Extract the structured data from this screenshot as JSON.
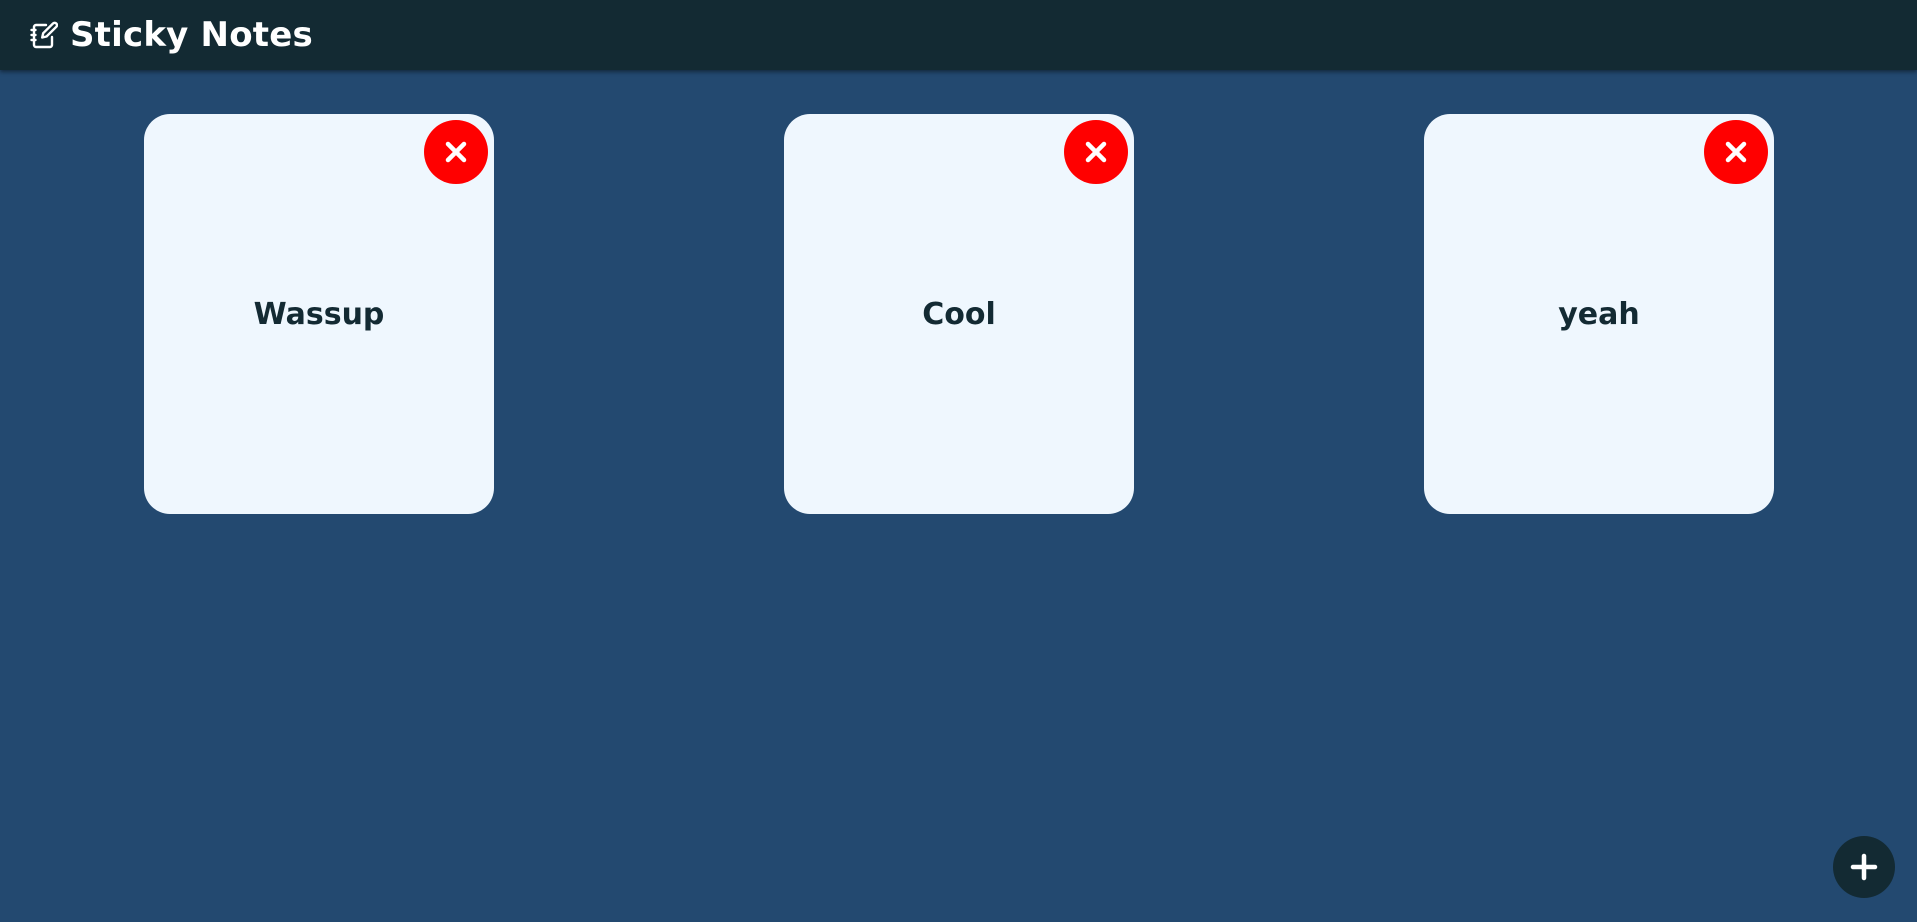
{
  "header": {
    "title": "Sticky Notes",
    "logo_icon": "notebook-pen-icon"
  },
  "notes": [
    {
      "text": "Wassup",
      "delete_icon": "close-icon"
    },
    {
      "text": "Cool",
      "delete_icon": "close-icon"
    },
    {
      "text": "yeah",
      "delete_icon": "close-icon"
    }
  ],
  "add_button": {
    "icon": "plus-icon"
  },
  "colors": {
    "background": "#234970",
    "header": "#132a33",
    "note": "#eff7fe",
    "note_text": "#132a33",
    "delete": "#ff0000",
    "add_button": "#132a33"
  }
}
